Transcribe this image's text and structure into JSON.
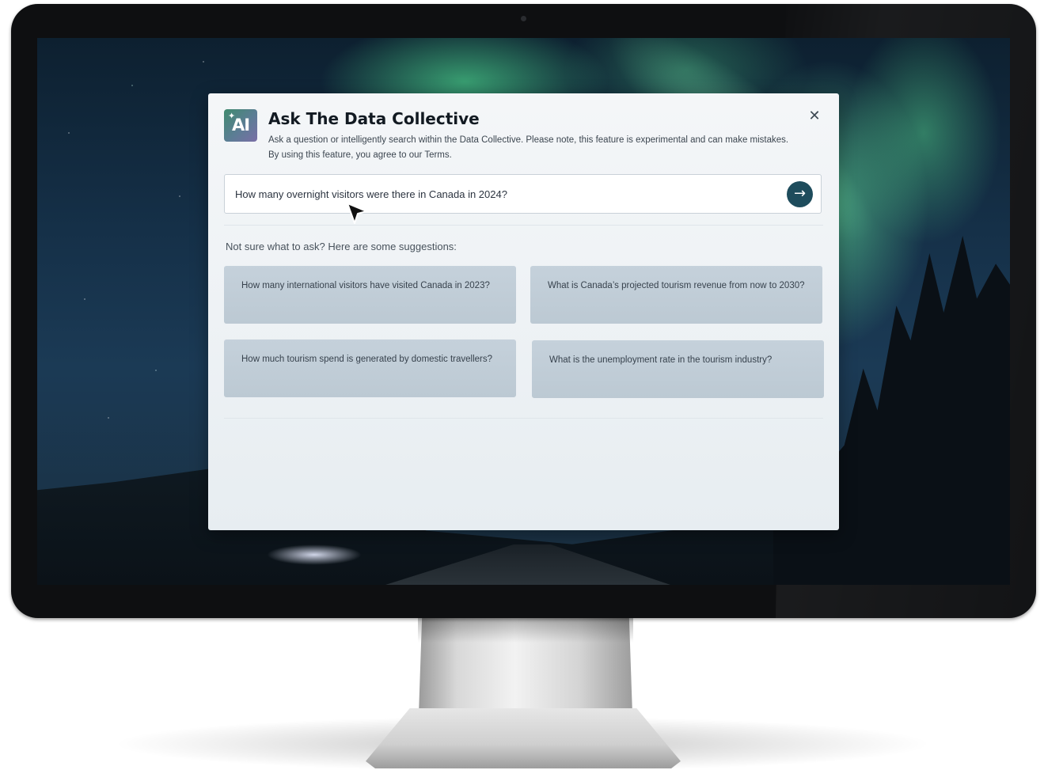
{
  "dialog": {
    "logo_text": "AI",
    "logo_sparkle": "✦",
    "title": "Ask The Data Collective",
    "description": "Ask a question or intelligently search within the Data Collective. Please note, this feature is experimental and can make mistakes. By using this feature, you agree to our Terms.",
    "close_glyph": "✕",
    "search": {
      "value": "How many overnight visitors were there in Canada in 2024?",
      "submit_glyph": "→"
    },
    "suggestions_label": "Not sure what to ask? Here are some suggestions:",
    "suggestions": [
      "How many international visitors have visited Canada in 2023?",
      "What is Canada’s projected tourism revenue from now  to 2030?",
      "How much tourism spend is generated by domestic travellers?",
      "What is the unemployment rate in the tourism industry?"
    ]
  },
  "icons": {
    "logo": "ai-sparkle-icon",
    "close": "close-icon",
    "submit": "arrow-right-icon",
    "cursor": "mouse-pointer-icon"
  },
  "colors": {
    "submit_button": "#1e4c5c",
    "suggestion_card": "#c5d1db",
    "dialog_background": "#f4f6f8",
    "title_text": "#121a22"
  }
}
